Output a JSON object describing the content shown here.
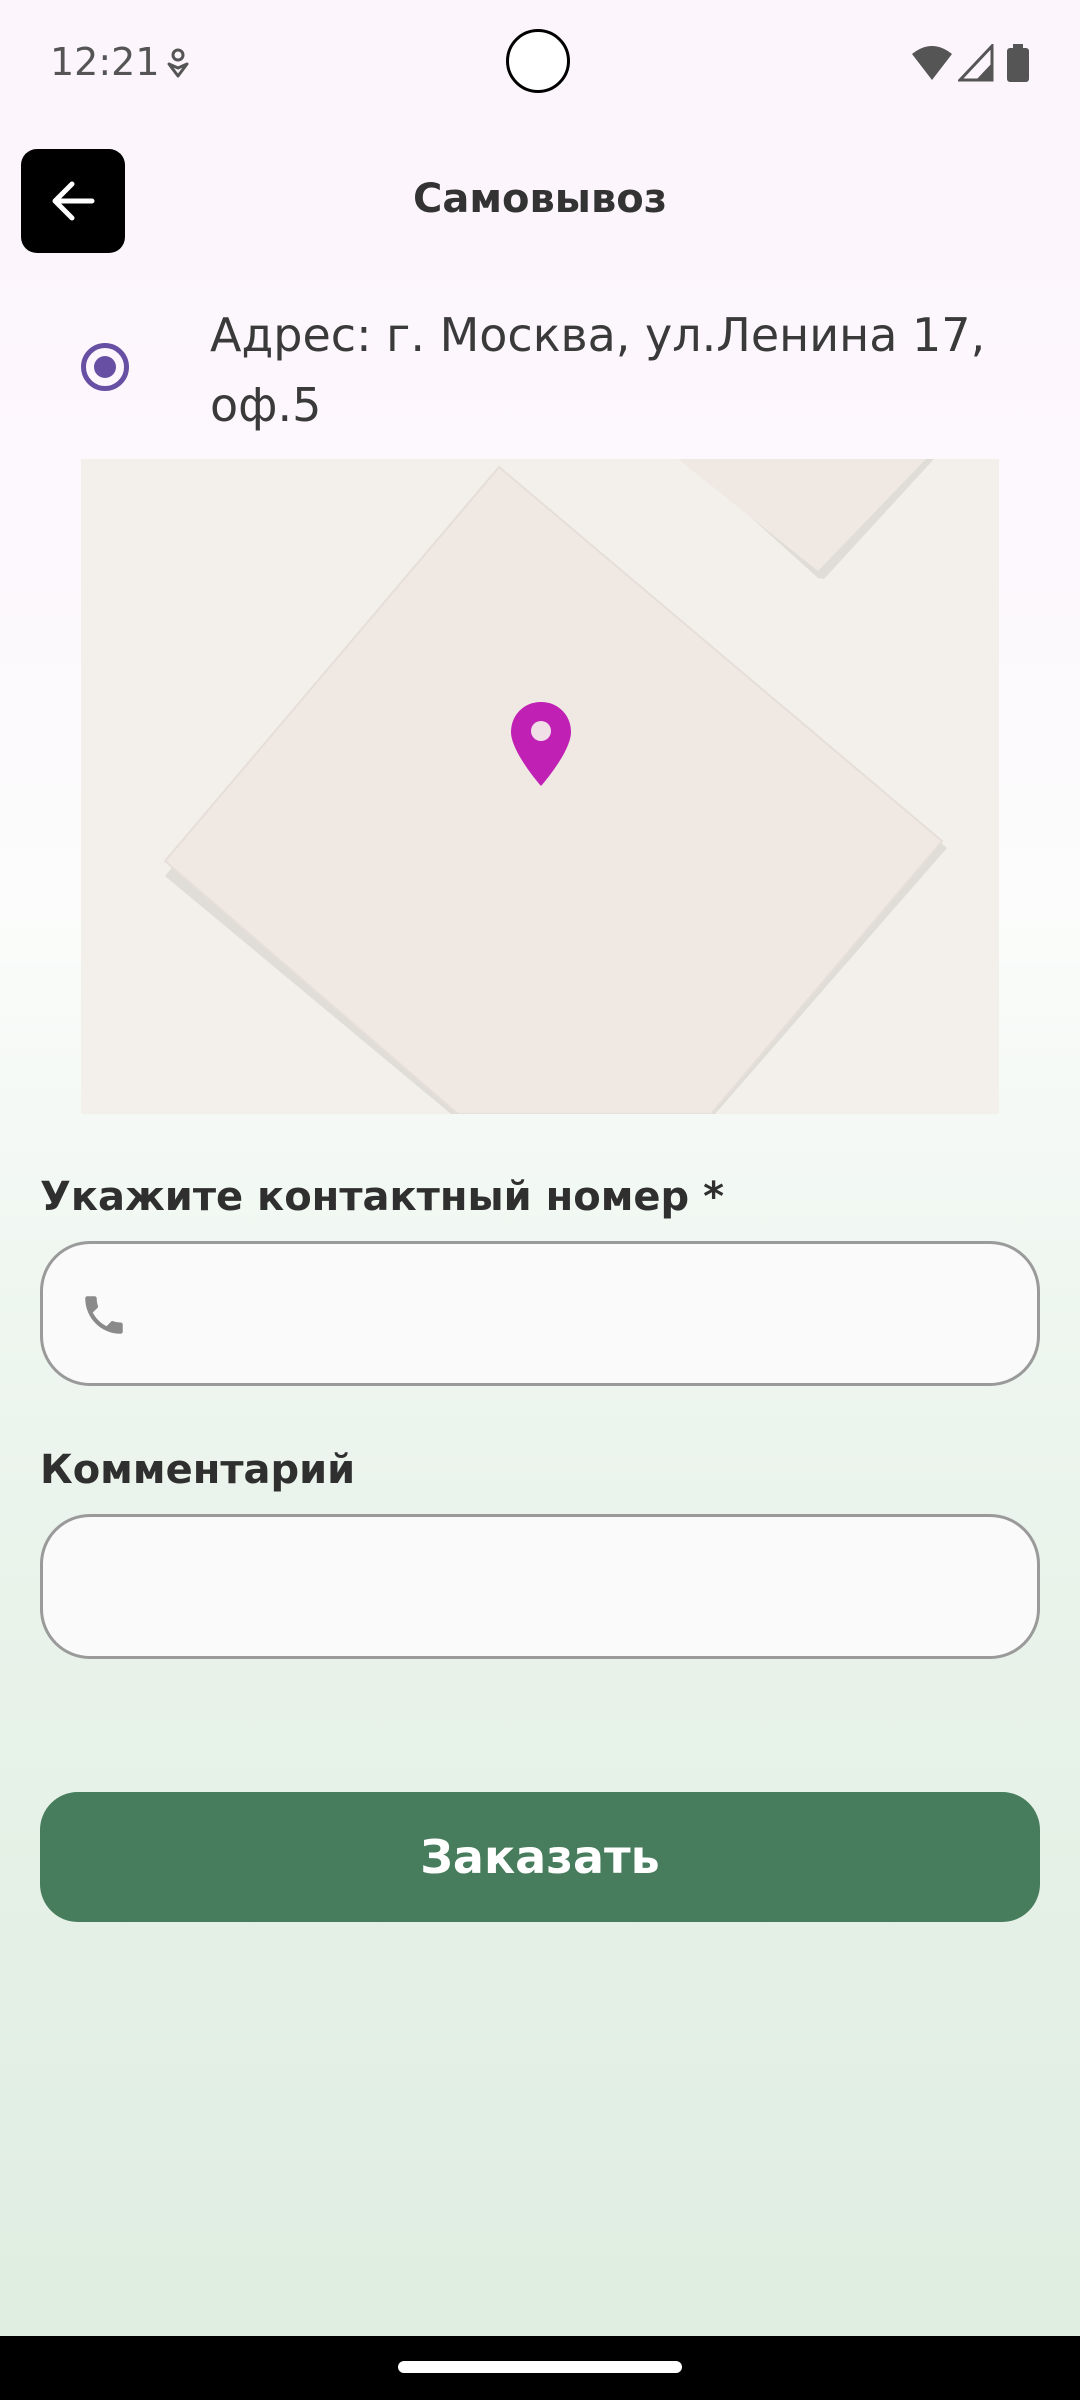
{
  "status_bar": {
    "time": "12:21",
    "icons": [
      "notification-icon",
      "wifi-icon",
      "signal-icon",
      "battery-icon"
    ]
  },
  "header": {
    "title": "Самовывоз",
    "back_icon": "arrow-back-icon"
  },
  "pickup": {
    "address": "Адрес: г. Москва, ул.Ленина 17, оф.5",
    "selected": true,
    "radio_color": "#6750a4"
  },
  "map": {
    "pin_icon": "location-pin-icon",
    "pin_color": "#c020b4"
  },
  "form": {
    "phone": {
      "label": "Укажите контактный номер *",
      "value": "",
      "placeholder": "",
      "icon": "phone-icon"
    },
    "comment": {
      "label": "Комментарий",
      "value": "",
      "placeholder": ""
    }
  },
  "actions": {
    "order_label": "Заказать",
    "order_color": "#477c5c"
  }
}
